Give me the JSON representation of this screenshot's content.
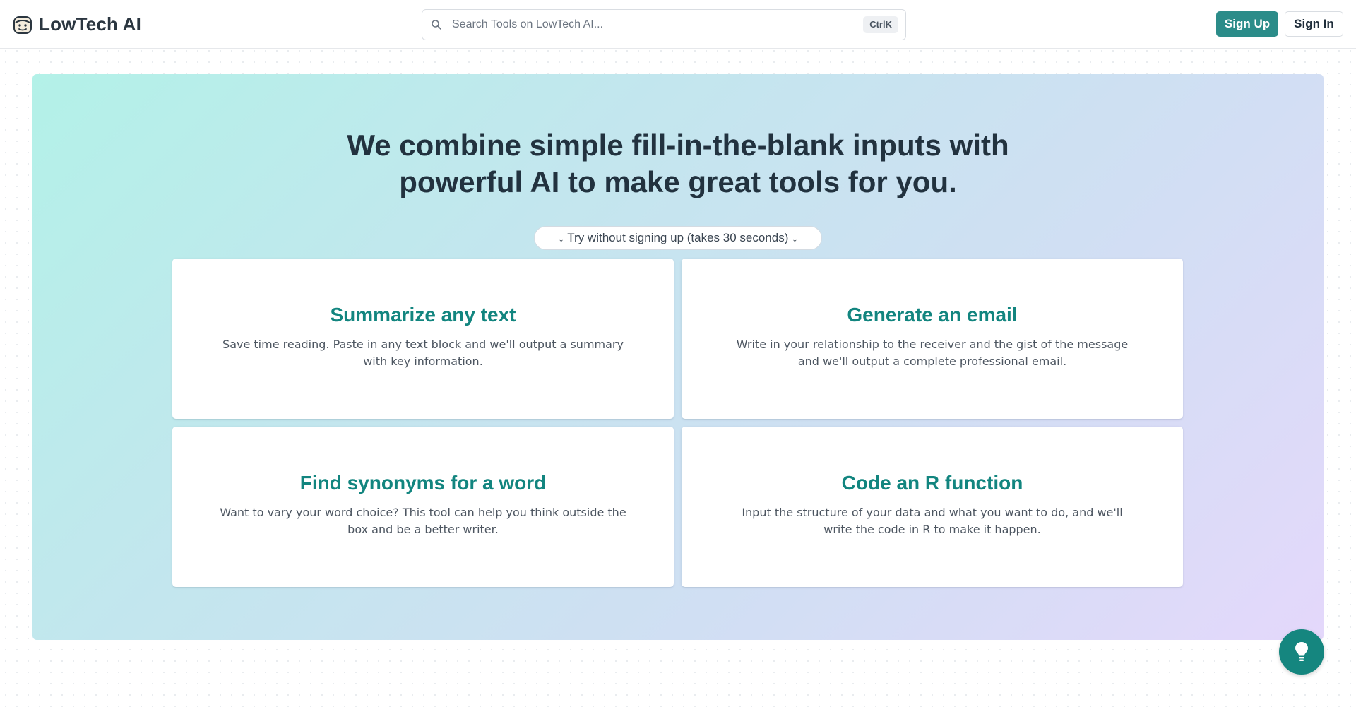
{
  "header": {
    "brand": "LowTech AI",
    "brand_icon": "robot-face-icon",
    "search": {
      "placeholder": "Search Tools on LowTech AI...",
      "shortcut": "CtrlK",
      "icon": "search-icon"
    },
    "signup_label": "Sign Up",
    "signin_label": "Sign In"
  },
  "hero": {
    "title_line1": "We combine simple fill-in-the-blank inputs with",
    "title_line2": "powerful AI to make great tools for you.",
    "try_label": "↓ Try without signing up (takes 30 seconds) ↓"
  },
  "tools": [
    {
      "title": "Summarize any text",
      "description": "Save time reading. Paste in any text block and we'll output a summary with key information."
    },
    {
      "title": "Generate an email",
      "description": "Write in your relationship to the receiver and the gist of the message and we'll output a complete professional email."
    },
    {
      "title": "Find synonyms for a word",
      "description": "Want to vary your word choice? This tool can help you think outside the box and be a better writer."
    },
    {
      "title": "Code an R function",
      "description": "Input the structure of your data and what you want to do, and we'll write the code in R to make it happen."
    }
  ],
  "fab": {
    "icon": "lightbulb-icon"
  },
  "colors": {
    "accent": "#2b8c89",
    "card_title": "#12857f",
    "fab": "#15867f"
  }
}
